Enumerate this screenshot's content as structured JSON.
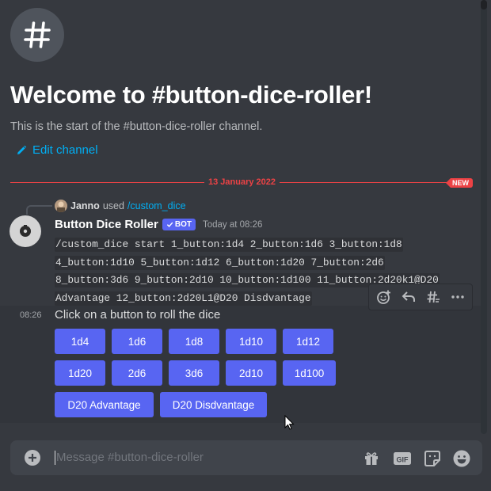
{
  "welcome": {
    "title": "Welcome to #button-dice-roller!",
    "subtitle": "This is the start of the #button-dice-roller channel.",
    "edit_label": "Edit channel"
  },
  "divider": {
    "date": "13 January 2022",
    "badge": "NEW"
  },
  "reply": {
    "user": "Janno",
    "used": "used",
    "command": "/custom_dice"
  },
  "message": {
    "author": "Button Dice Roller",
    "bot_tag": "BOT",
    "timestamp": "Today at 08:26",
    "code_lines": [
      "/custom_dice start 1_button:1d4 2_button:1d6 3_button:1d8",
      "4_button:1d10 5_button:1d12 6_button:1d20 7_button:2d6",
      "8_button:3d6 9_button:2d10 10_button:1d100 11_button:2d20k1@D20",
      "Advantage 12_button:2d20L1@D20 Disdvantage"
    ],
    "hover_time": "08:26",
    "text": "Click on a button to roll the dice"
  },
  "buttons": {
    "row1": [
      "1d4",
      "1d6",
      "1d8",
      "1d10",
      "1d12"
    ],
    "row2": [
      "1d20",
      "2d6",
      "3d6",
      "2d10",
      "1d100"
    ],
    "row3": [
      "D20 Advantage",
      "D20 Disdvantage"
    ]
  },
  "composer": {
    "placeholder": "Message #button-dice-roller"
  },
  "icons": {
    "channel": "hash-icon",
    "edit": "pencil-icon",
    "actions": [
      "add-reaction-icon",
      "reply-icon",
      "create-thread-icon",
      "more-icon"
    ],
    "composer": [
      "add-icon",
      "gift-icon",
      "gif-icon",
      "sticker-icon",
      "emoji-icon"
    ]
  },
  "colors": {
    "background": "#36393f",
    "accent": "#5865f2",
    "link": "#00aff4",
    "new": "#ed4245"
  }
}
